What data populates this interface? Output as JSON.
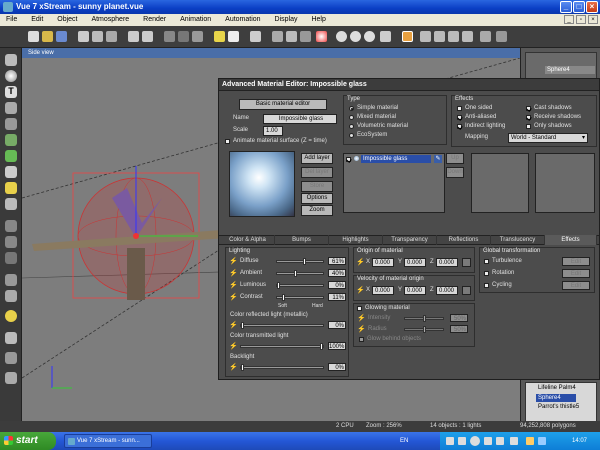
{
  "window": {
    "title": "Vue 7 xStream - sunny planet.vue"
  },
  "menu": [
    "File",
    "Edit",
    "Object",
    "Atmosphere",
    "Render",
    "Animation",
    "Automation",
    "Display",
    "Help"
  ],
  "viewport": {
    "title": "Side view"
  },
  "editor": {
    "title": "Advanced Material Editor: Impossible glass",
    "basic_button": "Basic material editor",
    "name_label": "Name",
    "name_value": "Impossible glass",
    "scale_label": "Scale",
    "scale_value": "1.00",
    "animate_label": "Animate material surface (Z = time)",
    "type": {
      "title": "Type",
      "options": [
        "Simple material",
        "Mixed material",
        "Volumetric material",
        "EcoSystem"
      ],
      "selected": "Simple material"
    },
    "effects": {
      "title": "Effects",
      "items": [
        {
          "label": "One sided",
          "checked": false
        },
        {
          "label": "Cast shadows",
          "checked": true
        },
        {
          "label": "Anti-aliased",
          "checked": true
        },
        {
          "label": "Receive shadows",
          "checked": true
        },
        {
          "label": "Indirect lighting",
          "checked": true
        },
        {
          "label": "Only shadows",
          "checked": false
        }
      ],
      "mapping_label": "Mapping",
      "mapping_value": "World - Standard"
    },
    "preview_buttons": [
      "Add layer",
      "Del layer",
      "Store",
      "Options",
      "Zoom"
    ],
    "layer_name": "Impossible glass",
    "layer_buttons": [
      "Up",
      "Down"
    ],
    "tabs": [
      "Color & Alpha",
      "Bumps",
      "Highlights",
      "Transparency",
      "Reflections",
      "Translucency",
      "Effects"
    ],
    "active_tab": "Effects",
    "lighting": {
      "title": "Lighting",
      "rows": [
        {
          "label": "Diffuse",
          "value": "61%",
          "fraction": 0.61
        },
        {
          "label": "Ambient",
          "value": "40%",
          "fraction": 0.4
        },
        {
          "label": "Luminous",
          "value": "0%",
          "fraction": 0.0
        },
        {
          "label": "Contrast",
          "value": "11%",
          "fraction": 0.11
        }
      ],
      "soft_label": "Soft",
      "hard_label": "Hard",
      "reflected_label": "Color reflected light (metallic)",
      "reflected_value": "0%",
      "transmitted_label": "Color transmitted light",
      "transmitted_value": "100%",
      "backlight_label": "Backlight",
      "backlight_value": "0%"
    },
    "origin": {
      "title": "Origin of material",
      "x": "0.000",
      "y": "0.000",
      "z": "0.000"
    },
    "velocity": {
      "title": "Velocity of material origin",
      "x": "0.000",
      "y": "0.000",
      "z": "0.000"
    },
    "glowing": {
      "title": "Glowing material",
      "intensity_label": "Intensity",
      "intensity_value": "50%",
      "radius_label": "Radius",
      "radius_value": "50%",
      "behind_label": "Glow behind objects"
    },
    "global": {
      "title": "Global transformation",
      "items": [
        "Turbulence",
        "Rotation",
        "Cycling"
      ],
      "edit_label": "Edit"
    }
  },
  "right_panel": {
    "items": [
      "Sphere4",
      "Lifeline Palm4",
      "Sphere4",
      "Parrot's thistle5"
    ]
  },
  "status": {
    "cpu": "2 CPU",
    "zoom": "Zoom : 256%",
    "objects": "14 objects : 1 lights",
    "polygons": "94,252,808 polygons"
  },
  "taskbar": {
    "start": "start",
    "item": "Vue 7 xStream - sunn...",
    "lang": "EN",
    "time": "14:07"
  }
}
